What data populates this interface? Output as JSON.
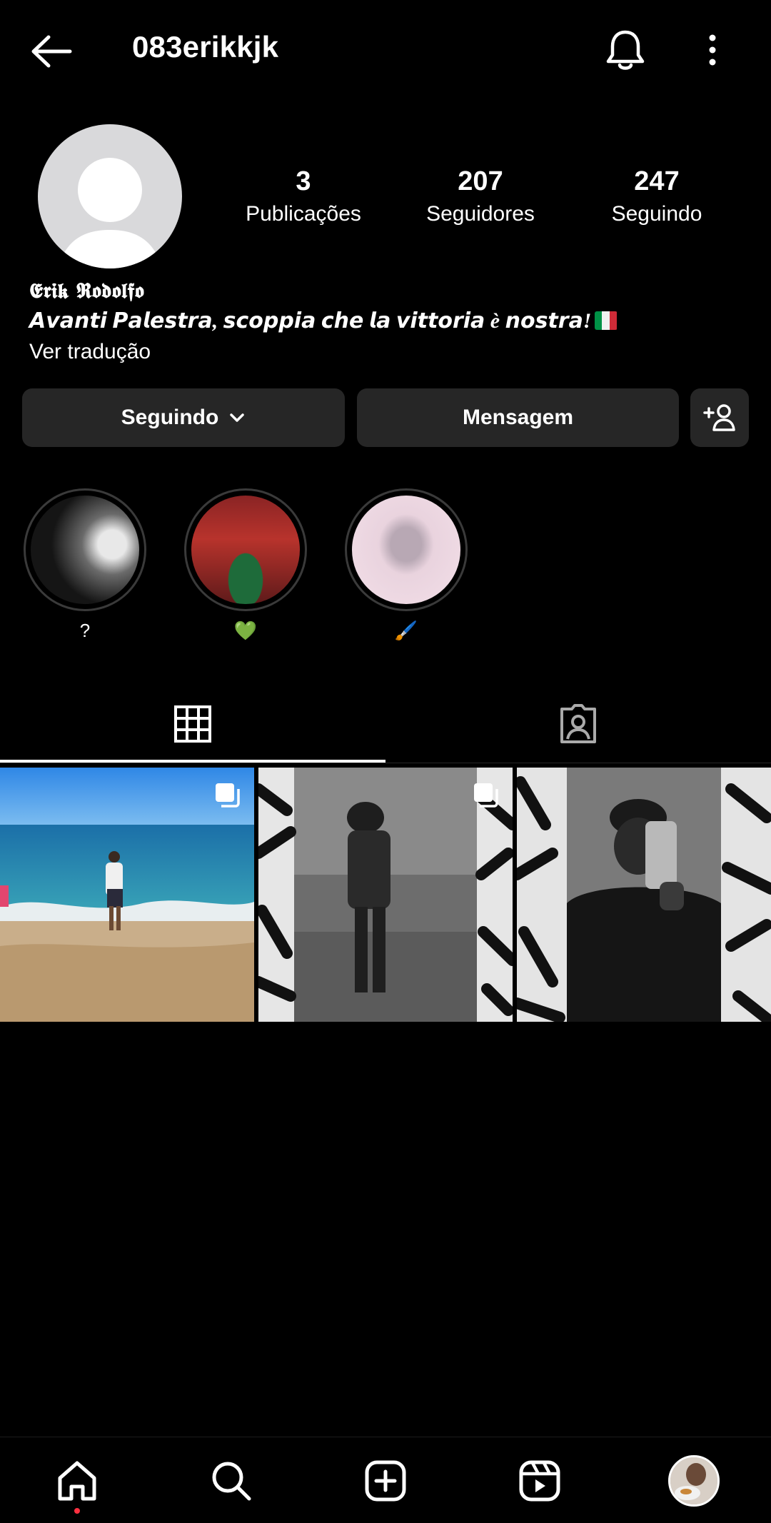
{
  "header": {
    "username": "083erikkjk",
    "back_icon": "arrow-left-icon",
    "bell_icon": "bell-icon",
    "more_icon": "more-vertical-icon"
  },
  "profile": {
    "stats": [
      {
        "value": "3",
        "label": "Publicações"
      },
      {
        "value": "207",
        "label": "Seguidores"
      },
      {
        "value": "247",
        "label": "Seguindo"
      }
    ],
    "name": "𝕰𝖗𝖎𝖐 𝕽𝖔𝖉𝖔𝖑𝖋𝖔",
    "bio": "𝘼𝙫𝙖𝙣𝙩𝙞 𝙋𝙖𝙡𝙚𝙨𝙩𝙧𝙖, 𝙨𝙘𝙤𝙥𝙥𝙞𝙖 𝙘𝙝𝙚 𝙡𝙖 𝙫𝙞𝙩𝙩𝙤𝙧𝙞𝙖 è 𝙣𝙤𝙨𝙩𝙧𝙖!",
    "translate": "Ver tradução"
  },
  "buttons": {
    "following": "Seguindo",
    "message": "Mensagem"
  },
  "highlights": [
    {
      "caption": "?"
    },
    {
      "caption": "💚"
    },
    {
      "caption": "🖌️"
    }
  ],
  "tabs": [
    "grid-icon",
    "tagged-icon"
  ],
  "nav": [
    "home-icon",
    "search-icon",
    "create-icon",
    "reels-icon",
    "profile-avatar"
  ],
  "colors": {
    "background": "#000000",
    "button": "#262626",
    "notification_dot": "#ff3040"
  }
}
